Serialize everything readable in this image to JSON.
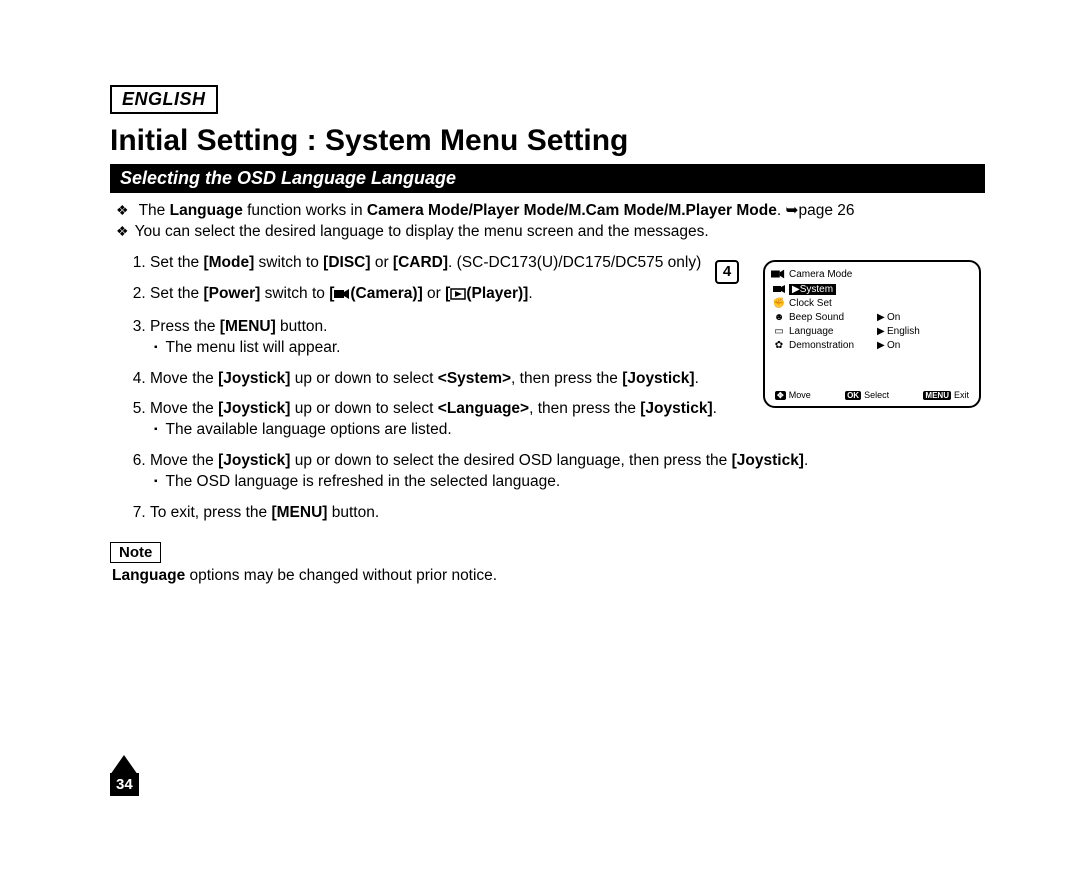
{
  "header": {
    "language_tag": "ENGLISH",
    "title": "Initial Setting : System Menu Setting",
    "section": "Selecting the OSD Language Language"
  },
  "intro": [
    {
      "pre": "The ",
      "b1": "Language",
      "mid": " function works in ",
      "b2": "Camera Mode/Player Mode/M.Cam Mode/M.Player Mode",
      "post": ". ",
      "page_ref": "page 26"
    },
    {
      "text": "You can select the desired language to display the menu screen and the messages."
    }
  ],
  "steps": {
    "s1": {
      "pre": "Set the ",
      "b1": "[Mode]",
      "mid": " switch to ",
      "b2": "[DISC]",
      "mid2": " or ",
      "b3": "[CARD]",
      "post": ". (SC-DC173(U)/DC175/DC575 only)"
    },
    "s2": {
      "pre": "Set the ",
      "b1": "[Power]",
      "mid": " switch to ",
      "b2": "[",
      "cam": "(Camera)]",
      "mid2": " or ",
      "b3": "[",
      "play": "(Player)]",
      "post": "."
    },
    "s3": {
      "pre": "Press the ",
      "b1": "[MENU]",
      "post": " button.",
      "sub": "The menu list will appear."
    },
    "s4": {
      "pre": "Move the ",
      "b1": "[Joystick]",
      "mid": " up or down to select ",
      "b2": "<System>",
      "mid2": ", then press the ",
      "b3": "[Joystick]",
      "post": "."
    },
    "s5": {
      "pre": "Move the ",
      "b1": "[Joystick]",
      "mid": " up or down to select ",
      "b2": "<Language>",
      "mid2": ", then press the ",
      "b3": "[Joystick]",
      "post": ".",
      "sub": "The available language options are listed."
    },
    "s6": {
      "pre": "Move the ",
      "b1": "[Joystick]",
      "mid": " up or down to select the desired OSD language, then press the ",
      "b2": "[Joystick]",
      "post": ".",
      "sub": "The OSD language is refreshed in the selected language."
    },
    "s7": {
      "pre": "To exit, press the ",
      "b1": "[MENU]",
      "post": " button."
    }
  },
  "note": {
    "label": "Note",
    "b1": "Language",
    "text": " options may be changed without prior notice."
  },
  "screen": {
    "step_number": "4",
    "title": "Camera Mode",
    "selected": "System",
    "items": [
      {
        "label": "Clock Set",
        "value": ""
      },
      {
        "label": "Beep Sound",
        "value": "On"
      },
      {
        "label": "Language",
        "value": "English"
      },
      {
        "label": "Demonstration",
        "value": "On"
      }
    ],
    "footer": {
      "move": "Move",
      "select": "Select",
      "exit": "Exit",
      "ok": "OK",
      "menu": "MENU"
    }
  },
  "page_number": "34"
}
